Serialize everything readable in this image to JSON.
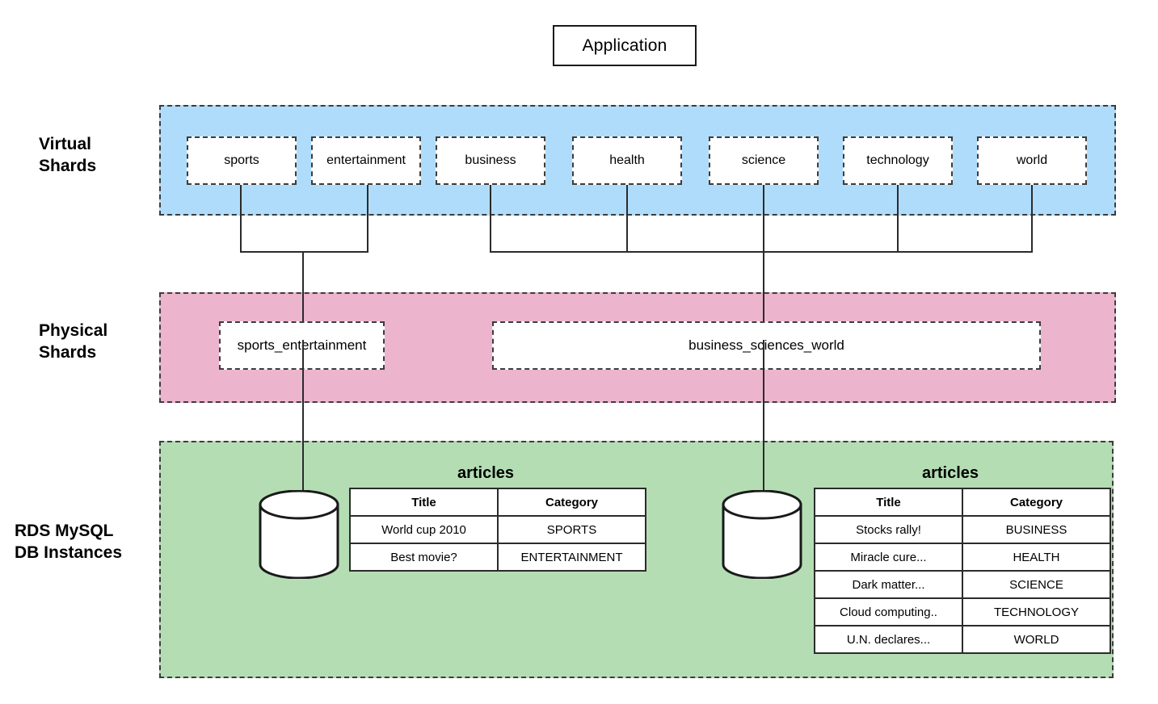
{
  "application": {
    "label": "Application"
  },
  "row_labels": {
    "virtual": "Virtual\nShards",
    "physical": "Physical\nShards",
    "rds": "RDS MySQL\nDB Instances"
  },
  "tiers": {
    "virtual": {
      "color": "#b0dcfb",
      "shards": [
        {
          "label": "sports"
        },
        {
          "label": "entertainment"
        },
        {
          "label": "business"
        },
        {
          "label": "health"
        },
        {
          "label": "science"
        },
        {
          "label": "technology"
        },
        {
          "label": "world"
        }
      ]
    },
    "physical": {
      "color": "#ecb5cd",
      "shards": [
        {
          "label": "sports_entertainment"
        },
        {
          "label": "business_sciences_world"
        }
      ]
    },
    "rds": {
      "color": "#b4ddb4",
      "instances": [
        {
          "table_title": "articles",
          "columns": [
            "Title",
            "Category"
          ],
          "rows": [
            [
              "World cup 2010",
              "SPORTS"
            ],
            [
              "Best movie?",
              "ENTERTAINMENT"
            ]
          ]
        },
        {
          "table_title": "articles",
          "columns": [
            "Title",
            "Category"
          ],
          "rows": [
            [
              "Stocks rally!",
              "BUSINESS"
            ],
            [
              "Miracle cure...",
              "HEALTH"
            ],
            [
              "Dark matter...",
              "SCIENCE"
            ],
            [
              "Cloud computing..",
              "TECHNOLOGY"
            ],
            [
              "U.N. declares...",
              "WORLD"
            ]
          ]
        }
      ]
    }
  }
}
